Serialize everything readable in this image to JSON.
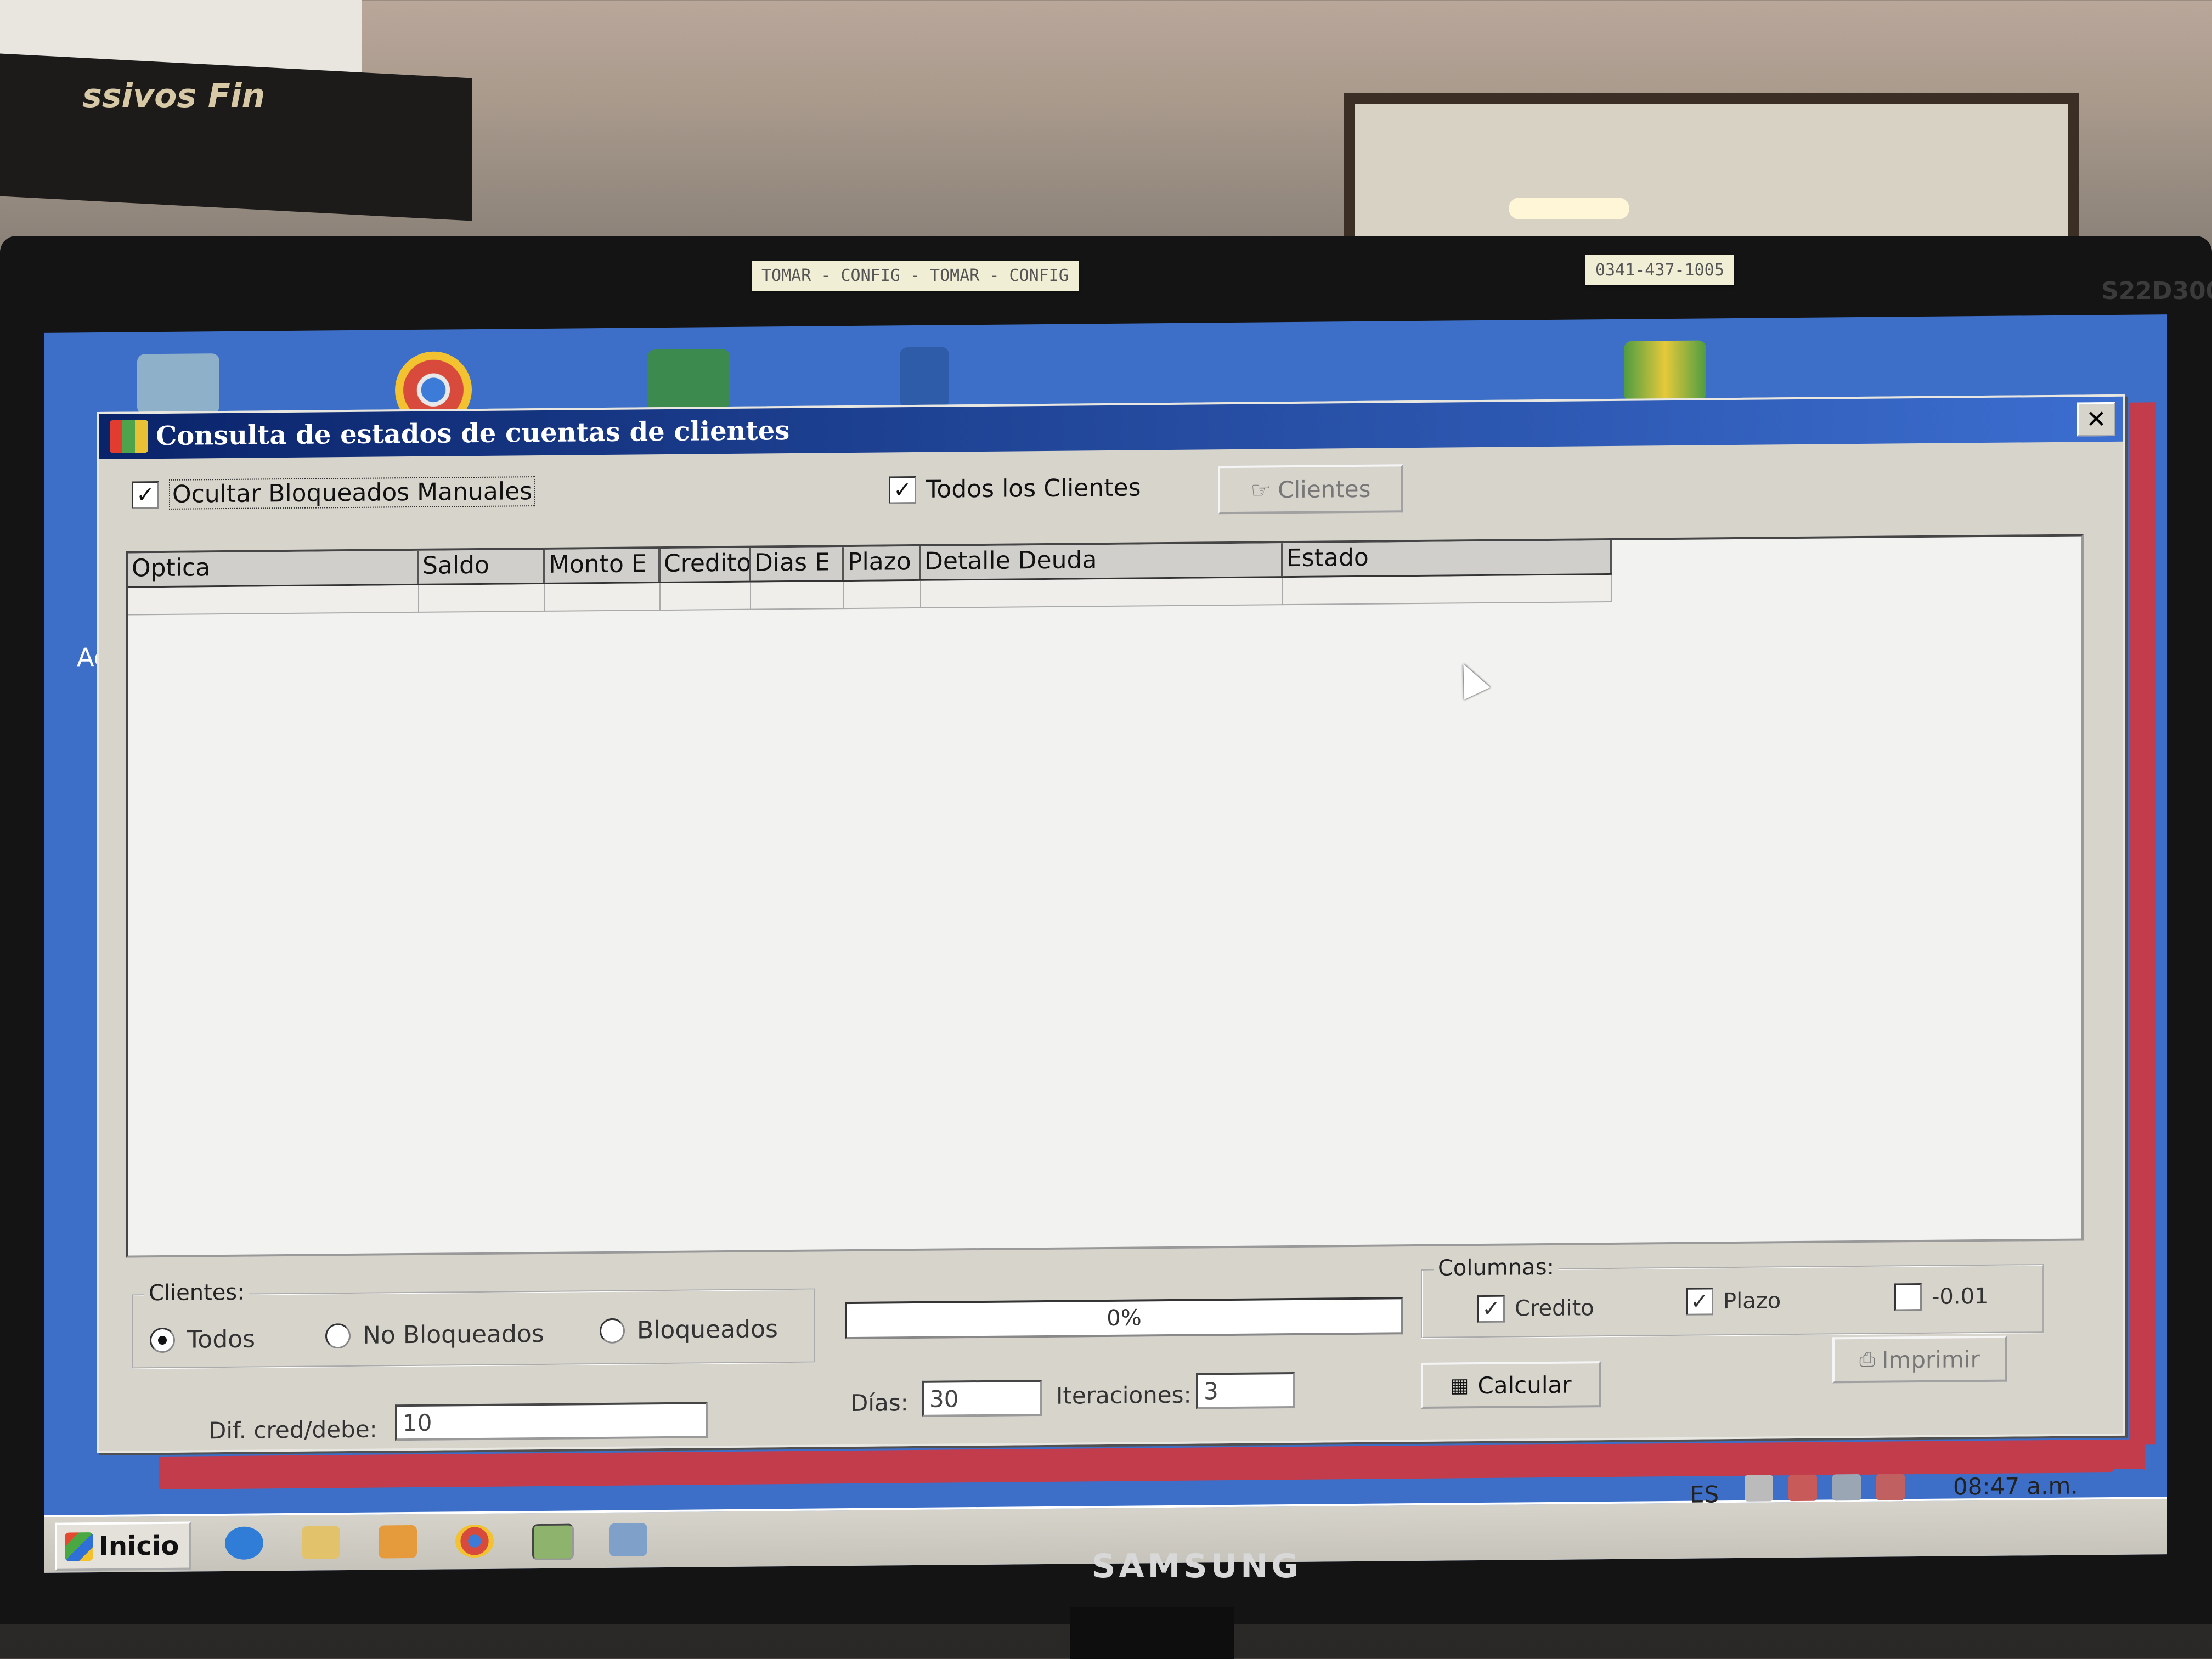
{
  "window": {
    "title": "Consulta de estados de cuentas de clientes",
    "close_label": "✕"
  },
  "top_options": {
    "ocultar_bloqueados": {
      "label": "Ocultar Bloqueados Manuales",
      "checked": true
    },
    "todos_clientes": {
      "label": "Todos los Clientes",
      "checked": true
    },
    "clientes_button": "Clientes"
  },
  "grid": {
    "columns": [
      "Optica",
      "Saldo",
      "Monto E",
      "Credito",
      "Dias E",
      "Plazo",
      "Detalle Deuda",
      "Estado"
    ],
    "rows": []
  },
  "clientes_group": {
    "label": "Clientes:",
    "options": [
      {
        "label": "Todos",
        "selected": true
      },
      {
        "label": "No Bloqueados",
        "selected": false
      },
      {
        "label": "Bloqueados",
        "selected": false
      }
    ]
  },
  "progress": {
    "text": "0%",
    "value": 0
  },
  "columnas_group": {
    "label": "Columnas:",
    "options": [
      {
        "label": "Credito",
        "checked": true
      },
      {
        "label": "Plazo",
        "checked": true
      },
      {
        "label": "-0.01",
        "checked": false
      }
    ]
  },
  "bottom": {
    "dif_label": "Dif. cred/debe:",
    "dif_value": "10",
    "dias_label": "Días:",
    "dias_value": "30",
    "iteraciones_label": "Iteraciones:",
    "iteraciones_value": "3",
    "calcular_button": "Calcular",
    "imprimir_button": "Imprimir"
  },
  "taskbar": {
    "start_label": "Inicio",
    "language": "ES",
    "clock": "08:47 a.m."
  },
  "scene": {
    "sticky_note_1": "TOMAR - CONFIG - TOMAR - CONFIG",
    "sticky_note_2": "0341-437-1005",
    "monitor_brand": "SAMSUNG",
    "monitor_model": "S22D300",
    "calendar_text": "ssivos Fin",
    "desktop_partial_text": "Ac"
  },
  "colors": {
    "titlebar": "#0a246a",
    "desktop": "#3d6fc8",
    "dialog_face": "#d7d4cc",
    "accent_red": "#c33c4c"
  }
}
